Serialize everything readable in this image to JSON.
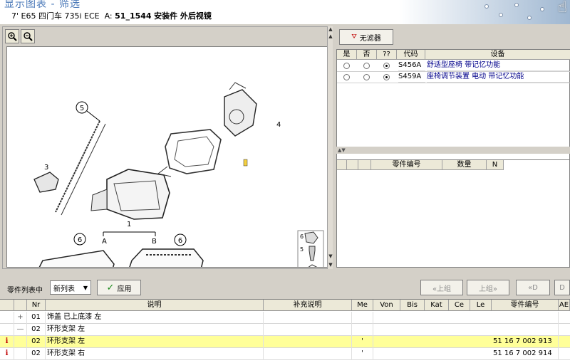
{
  "header": {
    "title": "显示图表 - 筛选",
    "vehicle": "7' E65 四门车 735i ECE",
    "group_prefix": "A:",
    "group_code": "51_1544",
    "group_name": "安装件 外后视镜"
  },
  "diagram": {
    "image_number": "03129839",
    "callouts": [
      "5",
      "4",
      "3",
      "1",
      "A",
      "B",
      "6",
      "6"
    ],
    "legend_items": [
      "6",
      "5"
    ]
  },
  "filter": {
    "button_label": "无滤器"
  },
  "conditions_table": {
    "headers": [
      "是",
      "否",
      "??",
      "代码",
      "设备"
    ],
    "rows": [
      {
        "yes": false,
        "no": false,
        "unknown": true,
        "code": "S456A",
        "equipment": "舒适型座椅 带记忆功能"
      },
      {
        "yes": false,
        "no": false,
        "unknown": true,
        "code": "S459A",
        "equipment": "座椅调节装置 电动 带记忆功能"
      }
    ]
  },
  "parts_number_table": {
    "headers": [
      "",
      "",
      "",
      "零件编号",
      "数量",
      "N"
    ]
  },
  "toolbar": {
    "parts_list_label": "零件列表中",
    "list_mode": "新列表",
    "apply_label": "应用",
    "prev_group_label": "«上组",
    "next_group_label": "上组»",
    "prev_d_label": "«D",
    "next_d_label": "D"
  },
  "parts_list": {
    "headers": [
      "",
      "",
      "Nr",
      "说明",
      "补充说明",
      "Me",
      "Von",
      "Bis",
      "Kat",
      "Ce",
      "Le",
      "零件编号",
      "AE"
    ],
    "rows": [
      {
        "marker": "",
        "toggle": "+",
        "nr": "01",
        "desc": "饰盖 已上底漆 左",
        "extra": "",
        "me": "",
        "part_no": "",
        "highlight": false
      },
      {
        "marker": "",
        "toggle": "—",
        "nr": "02",
        "desc": "环形支架 左",
        "extra": "",
        "me": "",
        "part_no": "",
        "highlight": false
      },
      {
        "marker": "i",
        "toggle": "",
        "nr": "02",
        "desc": "环形支架 左",
        "extra": "",
        "me": "'",
        "part_no": "51 16 7 002 913",
        "highlight": true
      },
      {
        "marker": "i",
        "toggle": "",
        "nr": "02",
        "desc": "环形支架 右",
        "extra": "",
        "me": "'",
        "part_no": "51 16 7 002 914",
        "highlight": false
      }
    ]
  }
}
